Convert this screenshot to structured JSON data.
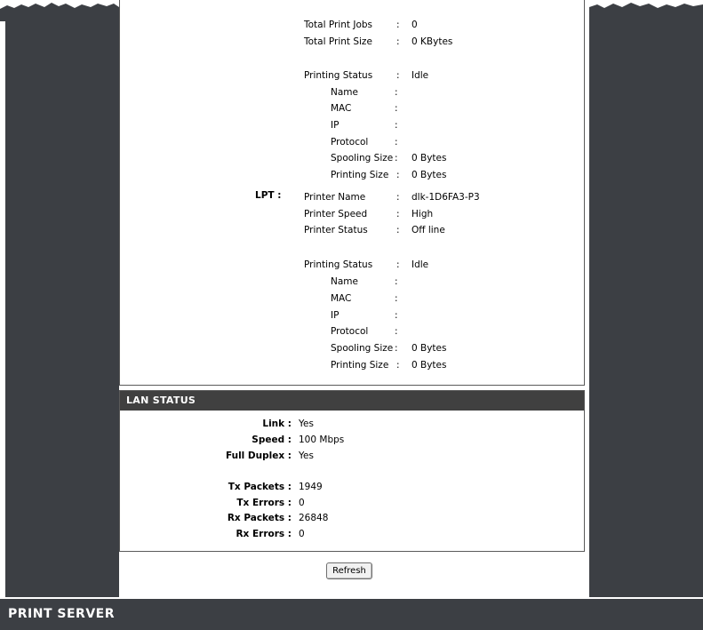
{
  "printer_stats": {
    "total_print_jobs_label": "Total Print Jobs",
    "total_print_jobs_value": "0",
    "total_print_size_label": "Total Print Size",
    "total_print_size_value": "0 KBytes",
    "printing_status_label": "Printing Status",
    "printing_status_value": "Idle",
    "name_label": "Name",
    "mac_label": "MAC",
    "ip_label": "IP",
    "protocol_label": "Protocol",
    "spooling_size_label": "Spooling Size",
    "spooling_size_value": "0 Bytes",
    "printing_size_label": "Printing Size",
    "printing_size_value": "0 Bytes"
  },
  "lpt": {
    "port_label": "LPT :",
    "printer_name_label": "Printer Name",
    "printer_name_value": "dlk-1D6FA3-P3",
    "printer_speed_label": "Printer Speed",
    "printer_speed_value": "High",
    "printer_status_label": "Printer Status",
    "printer_status_value": "Off line",
    "printing_status_label": "Printing Status",
    "printing_status_value": "Idle",
    "name_label": "Name",
    "mac_label": "MAC",
    "ip_label": "IP",
    "protocol_label": "Protocol",
    "spooling_size_label": "Spooling Size",
    "spooling_size_value": "0 Bytes",
    "printing_size_label": "Printing Size",
    "printing_size_value": "0 Bytes"
  },
  "separator": ":",
  "lan_status": {
    "title": "LAN STATUS",
    "link_label": "Link :",
    "link_value": "Yes",
    "speed_label": "Speed :",
    "speed_value": "100 Mbps",
    "full_duplex_label": "Full Duplex :",
    "full_duplex_value": "Yes",
    "tx_packets_label": "Tx Packets :",
    "tx_packets_value": "1949",
    "tx_errors_label": "Tx Errors :",
    "tx_errors_value": "0",
    "rx_packets_label": "Rx Packets :",
    "rx_packets_value": "26848",
    "rx_errors_label": "Rx Errors :",
    "rx_errors_value": "0"
  },
  "refresh_label": "Refresh",
  "footer_title": "PRINT SERVER",
  "colors": {
    "sidebar": "#3c3f44",
    "header_bar": "#404040",
    "panel_border": "#5a5a5a"
  }
}
